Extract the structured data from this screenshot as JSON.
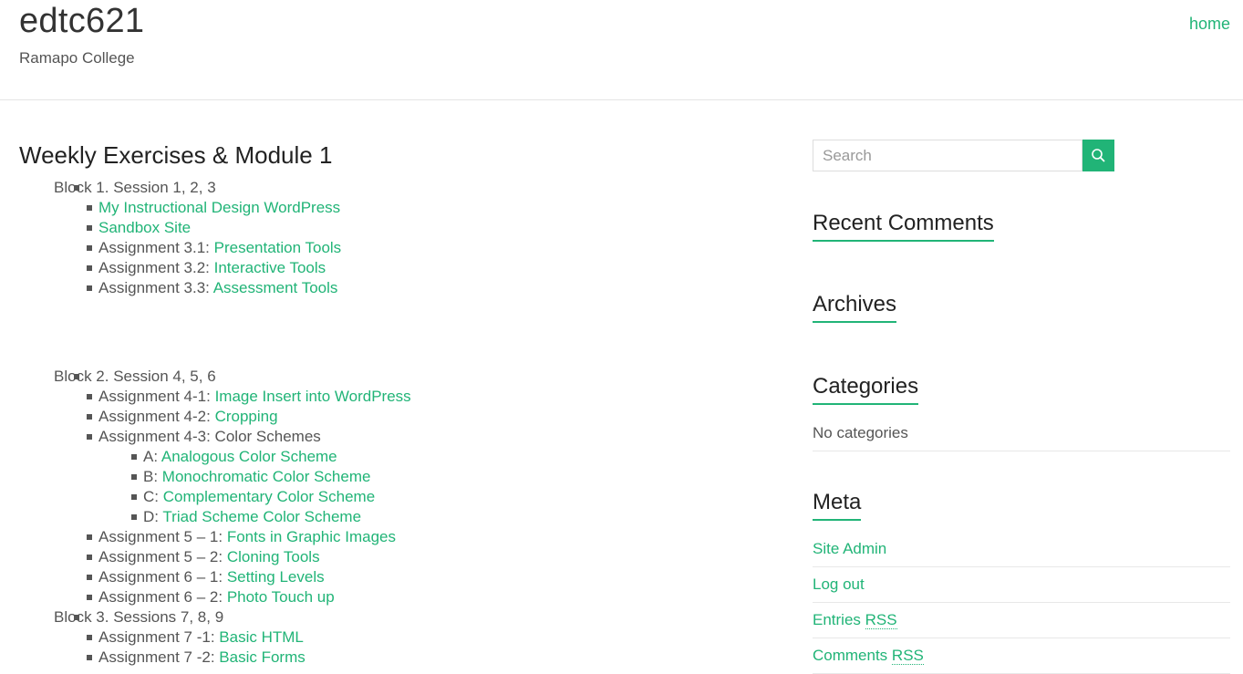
{
  "site": {
    "title": "edtc621",
    "description": "Ramapo College"
  },
  "nav": {
    "home": "home"
  },
  "page": {
    "title": "Weekly Exercises & Module 1"
  },
  "blocks": [
    {
      "label": "Block 1. Session 1, 2, 3",
      "items": [
        {
          "prefix": "",
          "link": "My Instructional Design WordPress"
        },
        {
          "prefix": "",
          "link": "Sandbox Site"
        },
        {
          "prefix": "Assignment 3.1: ",
          "link": "Presentation Tools"
        },
        {
          "prefix": "Assignment 3.2: ",
          "link": "Interactive Tools"
        },
        {
          "prefix": "Assignment 3.3: ",
          "link": "Assessment Tools"
        }
      ]
    },
    {
      "label": "Block 2. Session 4, 5, 6",
      "items": [
        {
          "prefix": "Assignment 4-1: ",
          "link": "Image Insert into WordPress"
        },
        {
          "prefix": "Assignment 4-2: ",
          "link": "Cropping"
        },
        {
          "prefix": "Assignment 4-3: Color Schemes",
          "link": ""
        },
        {
          "prefix": "Assignment 5 – 1: ",
          "link": "Fonts in Graphic Images"
        },
        {
          "prefix": "Assignment 5 – 2: ",
          "link": "Cloning Tools"
        },
        {
          "prefix": "Assignment 6 – 1: ",
          "link": "Setting Levels"
        },
        {
          "prefix": "Assignment 6 – 2: ",
          "link": "Photo Touch up"
        }
      ],
      "color_schemes": [
        {
          "prefix": "A: ",
          "link": "Analogous Color Scheme"
        },
        {
          "prefix": "B: ",
          "link": "Monochromatic Color Scheme"
        },
        {
          "prefix": "C: ",
          "link": "Complementary Color Scheme"
        },
        {
          "prefix": "D: ",
          "link": "Triad Scheme Color Scheme"
        }
      ]
    },
    {
      "label": "Block 3. Sessions 7, 8, 9",
      "items": [
        {
          "prefix": "Assignment 7 -1: ",
          "link": "Basic HTML"
        },
        {
          "prefix": "Assignment 7 -2: ",
          "link": "Basic Forms"
        }
      ]
    }
  ],
  "sidebar": {
    "search_placeholder": "Search",
    "recent_comments": "Recent Comments",
    "archives": "Archives",
    "categories": "Categories",
    "no_categories": "No categories",
    "meta": "Meta",
    "meta_links": {
      "site_admin": "Site Admin",
      "log_out": "Log out",
      "entries": "Entries ",
      "comments": "Comments ",
      "rss": "RSS"
    }
  },
  "colors": {
    "accent": "#21b477",
    "text": "#555555",
    "heading": "#222222"
  }
}
